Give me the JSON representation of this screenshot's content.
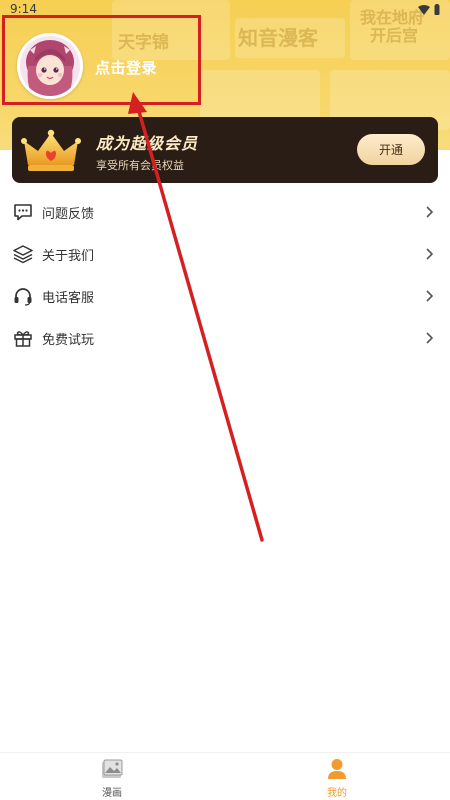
{
  "status_bar": {
    "time": "9:14"
  },
  "banner": {
    "deco_texts": [
      "天字锦",
      "知音漫客",
      "我在地府",
      "开后宫"
    ]
  },
  "profile": {
    "login_label": "点击登录"
  },
  "vip": {
    "title": "成为超级会员",
    "subtitle": "享受所有会员权益",
    "button_label": "开通"
  },
  "menu": {
    "items": [
      {
        "label": "问题反馈",
        "icon": "feedback-icon"
      },
      {
        "label": "关于我们",
        "icon": "layers-icon"
      },
      {
        "label": "电话客服",
        "icon": "headset-icon"
      },
      {
        "label": "免费试玩",
        "icon": "gift-icon"
      }
    ]
  },
  "bottom_nav": {
    "items": [
      {
        "label": "漫画",
        "icon": "image-icon",
        "active": false
      },
      {
        "label": "我的",
        "icon": "person-icon",
        "active": true
      }
    ]
  },
  "colors": {
    "banner": "#f6cf53",
    "vip_card": "#2a1d15",
    "vip_text": "#fde9c2",
    "active_tab": "#f39a2c",
    "annotation": "#d42020"
  }
}
